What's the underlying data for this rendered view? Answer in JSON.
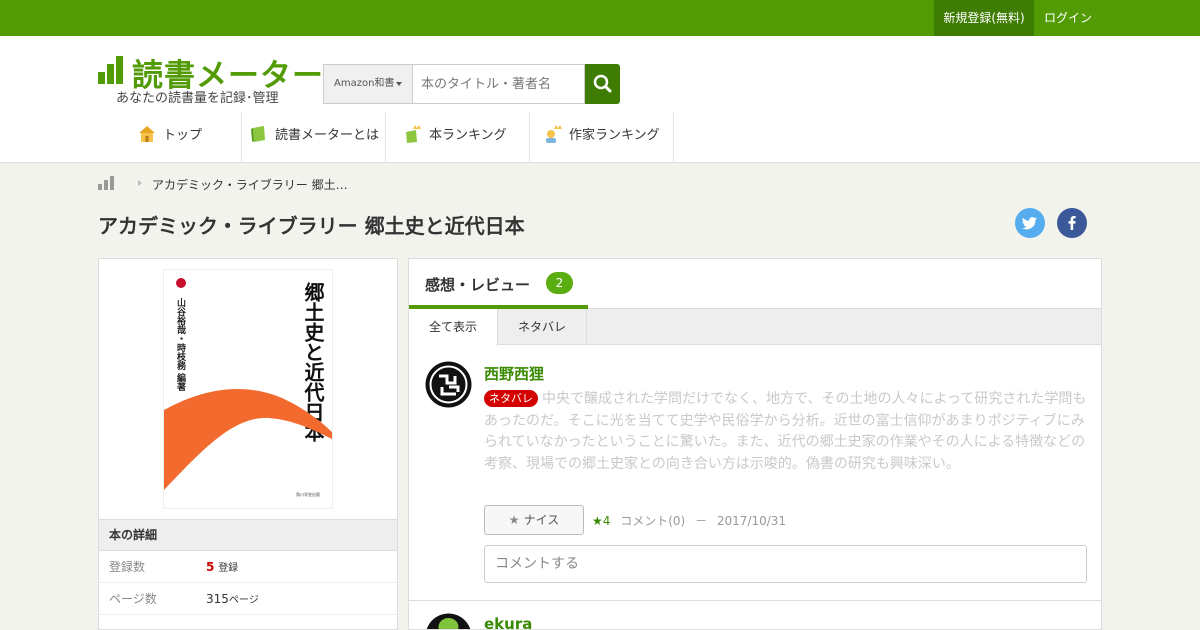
{
  "topbar": {
    "register": "新規登録(無料)",
    "login": "ログイン"
  },
  "logo": {
    "text": "読書メーター",
    "tagline": "あなたの読書量を記録･管理"
  },
  "search": {
    "category": "Amazon和書",
    "placeholder": "本のタイトル・著者名"
  },
  "nav": [
    {
      "label": "トップ",
      "icon": "house-icon"
    },
    {
      "label": "読書メーターとは",
      "icon": "book-icon"
    },
    {
      "label": "本ランキング",
      "icon": "book-crown-icon"
    },
    {
      "label": "作家ランキング",
      "icon": "author-crown-icon"
    }
  ],
  "breadcrumb": {
    "current": "アカデミック・ライブラリー 郷土…"
  },
  "book": {
    "title": "アカデミック・ライブラリー 郷土史と近代日本",
    "cover_title": "郷土史と近代日本",
    "cover_authors": "山谷裕哉・時枝務 編著",
    "cover_publisher": "角川学芸出版",
    "details_heading": "本の詳細",
    "details": [
      {
        "key": "登録数",
        "value": "5",
        "unit": "登録"
      },
      {
        "key": "ページ数",
        "value": "315",
        "unit": "ページ"
      }
    ]
  },
  "share": {
    "twitter": "t",
    "facebook": "f"
  },
  "reviews_panel": {
    "title": "感想・レビュー",
    "count": "2",
    "tabs": [
      "全て表示",
      "ネタバレ"
    ]
  },
  "reviews": [
    {
      "user": "西野西狸",
      "spoiler_label": "ネタバレ",
      "text": "中央で醸成された学問だけでなく、地方で、その土地の人々によって研究された学問もあったのだ。そこに光を当てて史学や民俗学から分析。近世の富士信仰があまりポジティブにみられていなかったということに驚いた。また、近代の郷土史家の作業やその人による特徴などの考察、現場での郷土史家との向き合い方は示唆的。偽書の研究も興味深い。",
      "nice_label": "ナイス",
      "likes": "★4",
      "comments": "コメント(0)",
      "separator": "－",
      "date": "2017/10/31",
      "comment_placeholder": "コメントする"
    },
    {
      "user": "ekura"
    }
  ],
  "colors": {
    "brand": "#529b05",
    "brand_dark": "#3f7c03",
    "spoiler": "#d40000",
    "twitter": "#55acee",
    "facebook": "#3b5998"
  }
}
